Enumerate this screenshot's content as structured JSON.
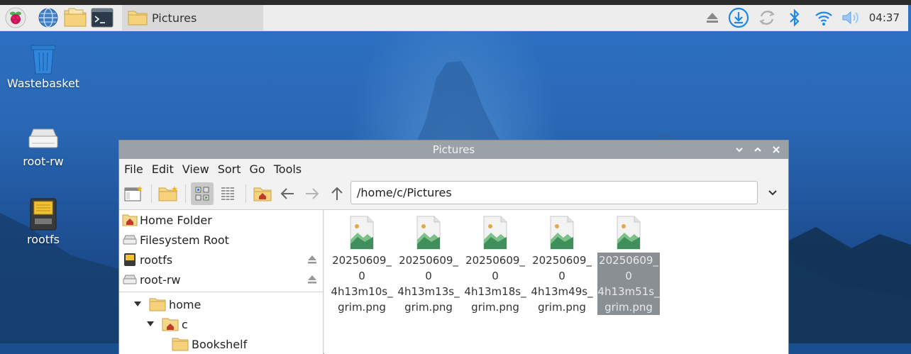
{
  "panel": {
    "task_title": "Pictures",
    "clock": "04:37",
    "icons": [
      "raspberry-menu-icon",
      "web-browser-icon",
      "file-manager-icon",
      "terminal-icon"
    ],
    "tray": [
      "eject-icon",
      "download-icon",
      "sync-icon",
      "bluetooth-icon",
      "wifi-icon",
      "volume-icon"
    ]
  },
  "desktop": {
    "icons": [
      {
        "label": "Wastebasket"
      },
      {
        "label": "root-rw"
      },
      {
        "label": "rootfs"
      }
    ]
  },
  "window": {
    "title": "Pictures",
    "menu": [
      "File",
      "Edit",
      "View",
      "Sort",
      "Go",
      "Tools"
    ],
    "path": "/home/c/Pictures",
    "places": [
      {
        "label": "Home Folder"
      },
      {
        "label": "Filesystem Root"
      },
      {
        "label": "rootfs"
      },
      {
        "label": "root-rw"
      }
    ],
    "tree": [
      {
        "label": "home"
      },
      {
        "label": "c"
      },
      {
        "label": "Bookshelf"
      }
    ],
    "files": [
      {
        "name": "20250609_04h13m10s_grim.png",
        "line1": "20250609_0",
        "line2": "4h13m10s_",
        "line3": "grim.png"
      },
      {
        "name": "20250609_04h13m13s_grim.png",
        "line1": "20250609_0",
        "line2": "4h13m13s_",
        "line3": "grim.png"
      },
      {
        "name": "20250609_04h13m18s_grim.png",
        "line1": "20250609_0",
        "line2": "4h13m18s_",
        "line3": "grim.png"
      },
      {
        "name": "20250609_04h13m49s_grim.png",
        "line1": "20250609_0",
        "line2": "4h13m49s_",
        "line3": "grim.png"
      },
      {
        "name": "20250609_04h13m51s_grim.png",
        "line1": "20250609_0",
        "line2": "4h13m51s_",
        "line3": "grim.png",
        "selected": true
      }
    ]
  },
  "colors": {
    "accent": "#1e88e5",
    "titlebar": "#9aa1a7",
    "selection": "#8a8f94"
  }
}
